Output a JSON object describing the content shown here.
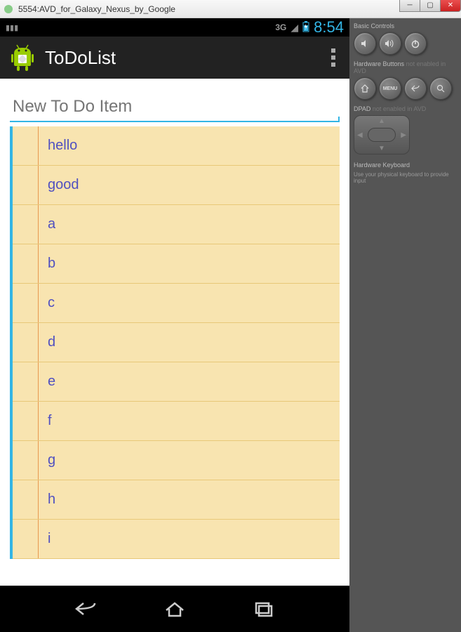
{
  "window": {
    "title": "5554:AVD_for_Galaxy_Nexus_by_Google"
  },
  "status_bar": {
    "network": "3G",
    "time": "8:54"
  },
  "action_bar": {
    "title": "ToDoList"
  },
  "input": {
    "placeholder": "New To Do Item",
    "value": ""
  },
  "todo_items": [
    {
      "text": "hello"
    },
    {
      "text": "good"
    },
    {
      "text": "a"
    },
    {
      "text": "b"
    },
    {
      "text": "c"
    },
    {
      "text": "d"
    },
    {
      "text": "e"
    },
    {
      "text": "f"
    },
    {
      "text": "g"
    },
    {
      "text": "h"
    },
    {
      "text": "i"
    }
  ],
  "emulator": {
    "basic_controls": "Basic Controls",
    "hw_buttons": "Hardware Buttons",
    "hw_buttons_hint": "not enabled in AVD",
    "dpad": "DPAD",
    "dpad_hint": "not enabled in AVD",
    "menu_label": "MENU",
    "hw_keyboard": "Hardware Keyboard",
    "hw_keyboard_hint": "Use your physical keyboard to provide input"
  }
}
